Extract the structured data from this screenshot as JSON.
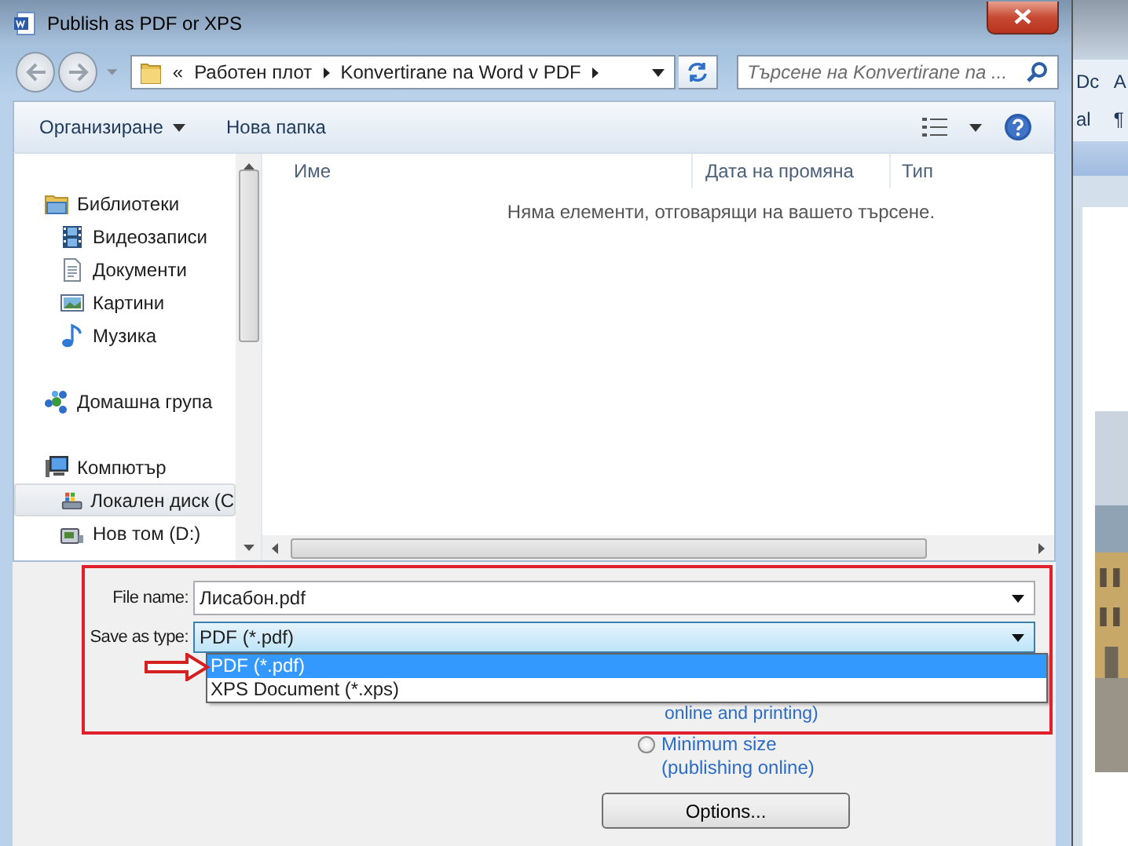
{
  "window": {
    "title": "Publish as PDF or XPS"
  },
  "address_bar": {
    "overflow": "«",
    "crumbs": [
      "Работен плот",
      "Konvertirane na Word v PDF"
    ]
  },
  "search": {
    "placeholder": "Търсене на Konvertirane na ..."
  },
  "toolbar": {
    "items": [
      {
        "label": "Организиране",
        "has_menu": true
      },
      {
        "label": "Нова папка",
        "has_menu": false
      }
    ]
  },
  "sidebar": {
    "items": [
      {
        "label": "Библиотеки",
        "kind": "library",
        "selected": false,
        "children": [
          {
            "label": "Видеозаписи",
            "kind": "video",
            "selected": false
          },
          {
            "label": "Документи",
            "kind": "document",
            "selected": false
          },
          {
            "label": "Картини",
            "kind": "picture",
            "selected": false
          },
          {
            "label": "Музика",
            "kind": "music",
            "selected": false
          }
        ]
      },
      {
        "label": "Домашна група",
        "kind": "homegroup",
        "selected": false
      },
      {
        "label": "Компютър",
        "kind": "computer",
        "selected": false,
        "children": [
          {
            "label": "Локален диск (C",
            "kind": "system-drive",
            "selected": true
          },
          {
            "label": "Нов том (D:)",
            "kind": "drive",
            "selected": false
          }
        ]
      }
    ]
  },
  "table": {
    "columns": [
      "Име",
      "Дата на промяна",
      "Тип"
    ],
    "empty_message": "Няма елементи, отговарящи на вашето търсене."
  },
  "form": {
    "file_name": {
      "label": "File name:",
      "value": "Лисабон.pdf"
    },
    "save_as_type": {
      "label": "Save as type:",
      "value": "PDF (*.pdf)",
      "expanded": true,
      "options": [
        {
          "label": "PDF (*.pdf)",
          "selected": true
        },
        {
          "label": "XPS Document (*.xps)",
          "selected": false
        }
      ]
    }
  },
  "optimize": {
    "partial_label": "online and printing)",
    "options": [
      {
        "label": "Minimum size\n(publishing online)",
        "selected": false
      }
    ]
  },
  "buttons": [
    {
      "label": "Options..."
    }
  ],
  "background_window": {
    "texts": [
      "Dc",
      "A",
      "al",
      "¶"
    ]
  }
}
